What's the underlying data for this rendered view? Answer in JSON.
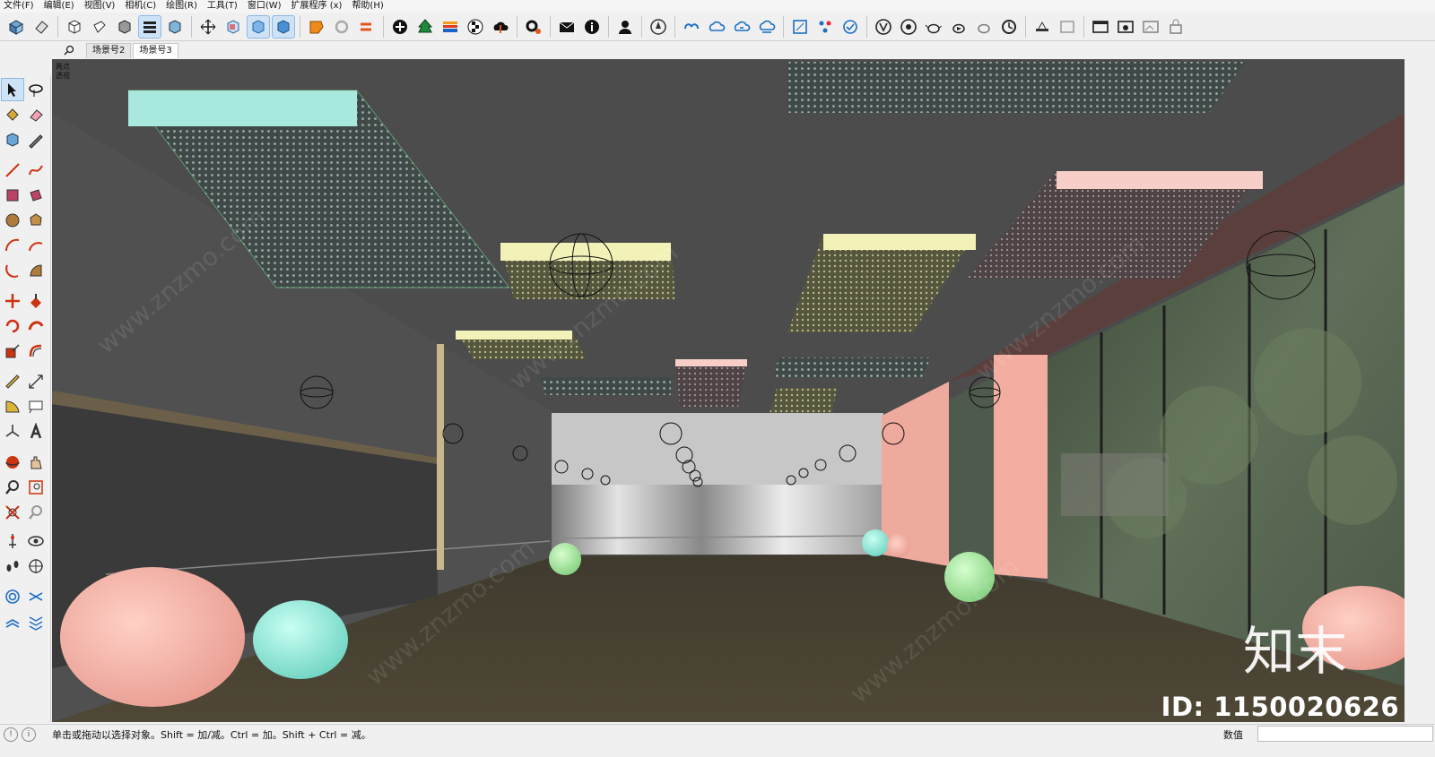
{
  "menu": [
    "文件(F)",
    "编辑(E)",
    "视图(V)",
    "相机(C)",
    "绘图(R)",
    "工具(T)",
    "窗口(W)",
    "扩展程序 (x)",
    "帮助(H)"
  ],
  "scene_tabs": [
    {
      "label": "场景号2",
      "active": false
    },
    {
      "label": "场景号3",
      "active": true
    }
  ],
  "viewport": {
    "view_label_line1": "两点",
    "view_label_line2": "透视",
    "watermark_site": "www.znzmo.com",
    "watermark_brand": "知末",
    "watermark_id": "ID: 1150020626"
  },
  "status": {
    "hint": "单击或拖动以选择对象。Shift = 加/减。Ctrl = 加。Shift + Ctrl = 减。",
    "measurements_label": "数值",
    "measurements_value": ""
  },
  "toolbar_icons": [
    "component-icon",
    "eraser-shape-icon",
    "box-icon",
    "box-outline-icon",
    "box-solid-icon",
    "layers-icon",
    "box-tinted-icon",
    "move-icon",
    "cube-back-icon",
    "cube-iso-icon",
    "cube-front-icon",
    "extension-warehouse-icon",
    "refresh-icon",
    "swap-icon",
    "add-icon",
    "tree-icon",
    "stripes-icon",
    "checker-icon",
    "cloud-upload-icon",
    "gears-icon",
    "mail-icon",
    "info-icon",
    "user-icon",
    "compass-icon",
    "cloud-link-icon",
    "cloud-share-icon",
    "cloud-sync-icon",
    "cloud-stack-icon",
    "frame-icon",
    "molecule-icon",
    "check-refresh-icon",
    "vray-icon",
    "vray-asset-icon",
    "teapot-icon",
    "teapot-render-icon",
    "teapot-interactive-icon",
    "teapot-lock-icon",
    "lamp-icon",
    "image-icon",
    "window-icon",
    "window-render-icon",
    "image-frame-icon",
    "lock-frame-icon"
  ],
  "colors": {
    "floor": "#4d4535",
    "ceiling": "#4a4a4a",
    "wall_left": "#525252",
    "glass_wall": "#4a5a49",
    "accent_pink": "#f7b7a8",
    "accent_mint": "#a6efe0",
    "accent_yellow": "#f2f2b8",
    "accent_green": "#a6e8a2"
  }
}
